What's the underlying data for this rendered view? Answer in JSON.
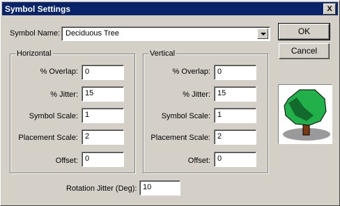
{
  "dialog": {
    "title": "Symbol Settings",
    "close_label": "X"
  },
  "symbol": {
    "label": "Symbol Name:",
    "value": "Deciduous Tree"
  },
  "buttons": {
    "ok": "OK",
    "cancel": "Cancel"
  },
  "horizontal": {
    "title": "Horizontal",
    "fields": [
      {
        "label": "% Overlap:",
        "value": "0"
      },
      {
        "label": "% Jitter:",
        "value": "15"
      },
      {
        "label": "Symbol Scale:",
        "value": "1"
      },
      {
        "label": "Placement Scale:",
        "value": "2"
      },
      {
        "label": "Offset:",
        "value": "0"
      }
    ]
  },
  "vertical": {
    "title": "Vertical",
    "fields": [
      {
        "label": "% Overlap:",
        "value": "0"
      },
      {
        "label": "% Jitter:",
        "value": "15"
      },
      {
        "label": "Symbol Scale:",
        "value": "1"
      },
      {
        "label": "Placement Scale:",
        "value": "2"
      },
      {
        "label": "Offset:",
        "value": "0"
      }
    ]
  },
  "rotation": {
    "label": "Rotation Jitter (Deg):",
    "value": "10"
  },
  "preview": {
    "icon": "deciduous-tree-icon"
  }
}
